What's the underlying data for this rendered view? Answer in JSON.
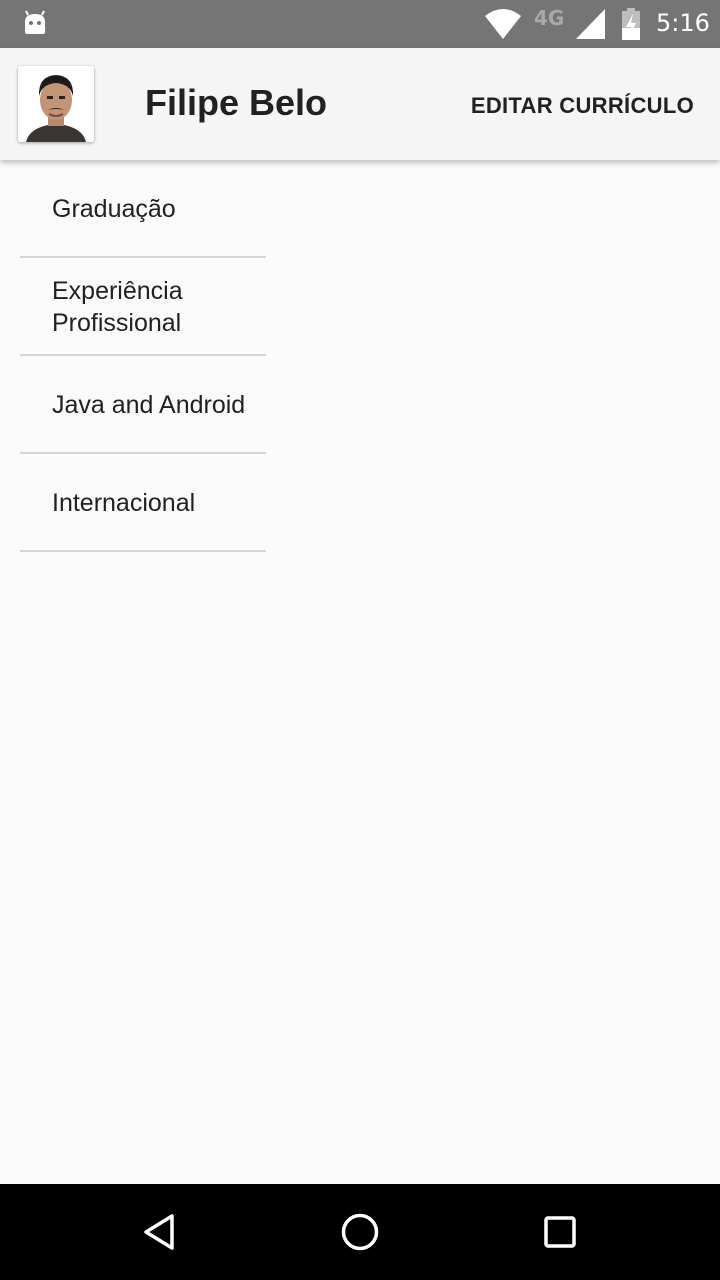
{
  "status_bar": {
    "network": "4G",
    "time": "5:16",
    "icons": [
      "android-icon",
      "wifi-icon",
      "signal-icon",
      "battery-charging-icon"
    ]
  },
  "app_bar": {
    "name": "Filipe Belo",
    "edit_label": "EDITAR CURRÍCULO",
    "avatar_icon": "profile-photo"
  },
  "menu": {
    "items": [
      {
        "label": "Graduação"
      },
      {
        "label": "Experiência Profissional"
      },
      {
        "label": "Java and Android"
      },
      {
        "label": "Internacional"
      }
    ]
  },
  "nav_bar": {
    "icons": [
      "back-icon",
      "home-icon",
      "recents-icon"
    ]
  },
  "colors": {
    "status_bar": "#757575",
    "app_bar": "#f5f5f5",
    "background": "#fafafa",
    "divider": "#d6d6d6",
    "nav_bar": "#000000"
  }
}
